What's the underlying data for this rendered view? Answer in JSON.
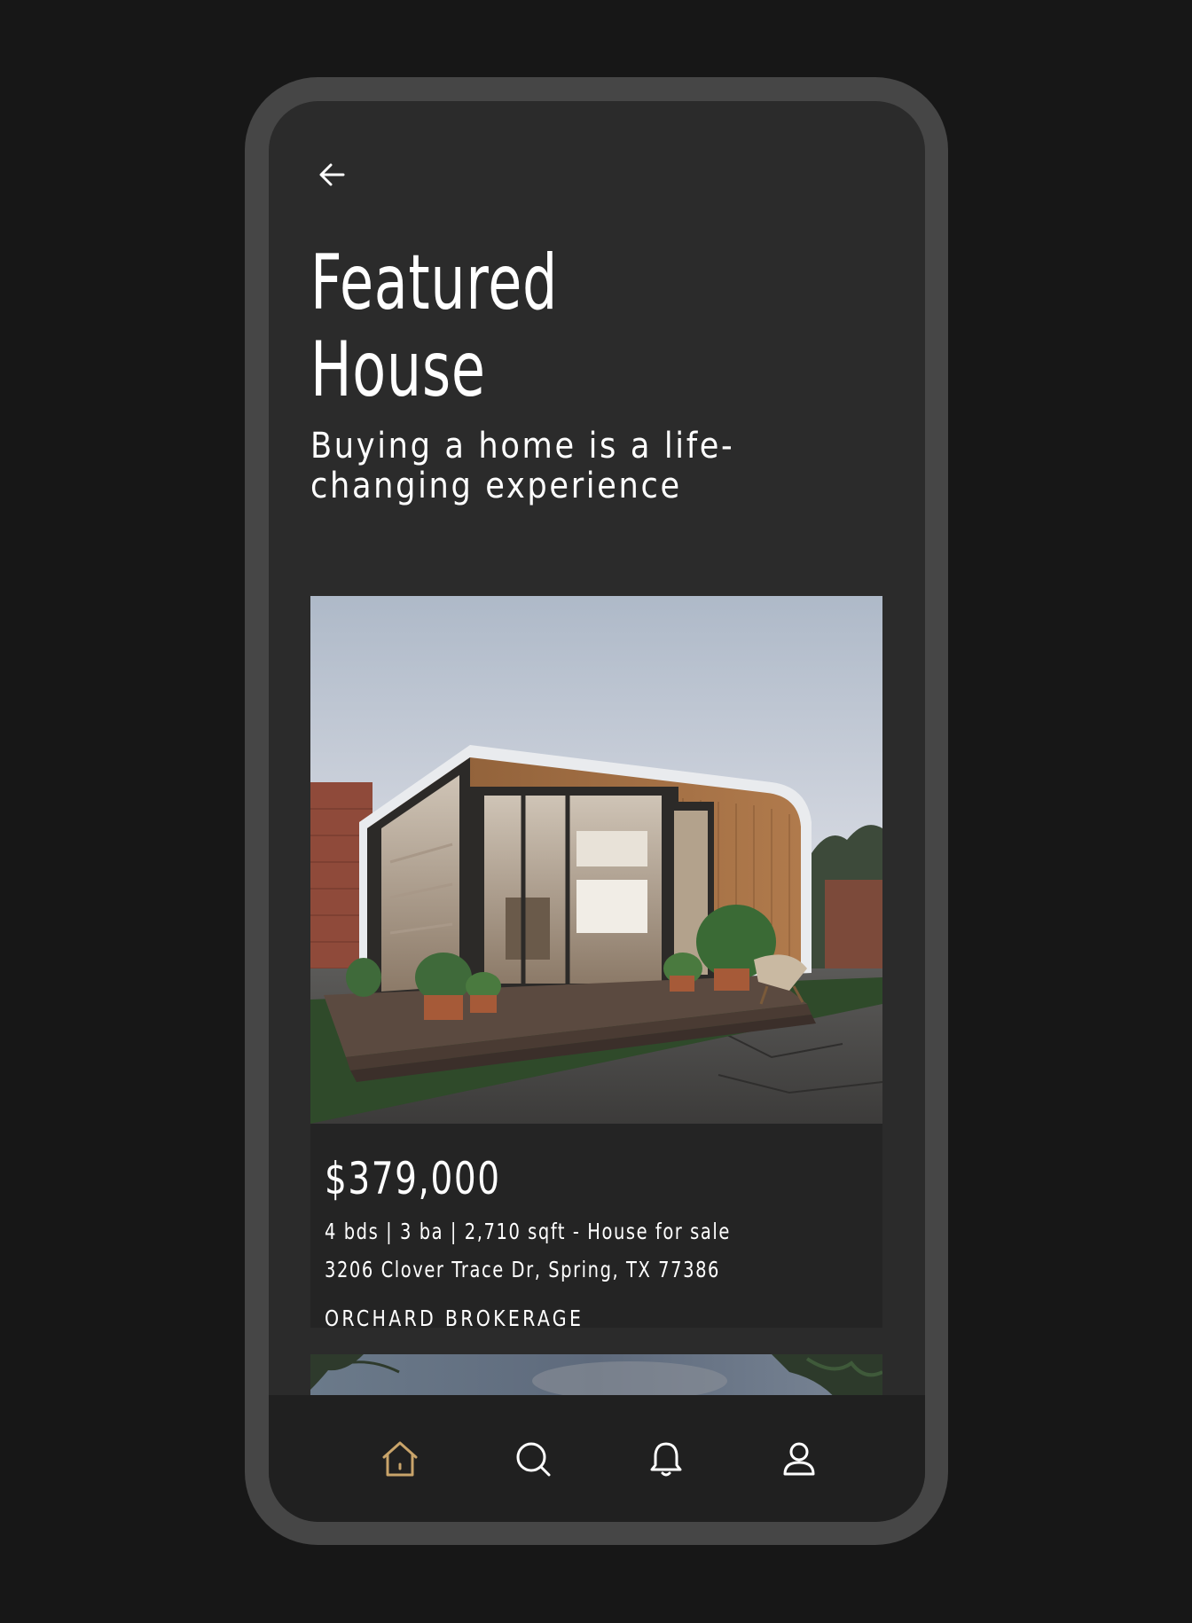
{
  "theme": {
    "background": "#171717",
    "frame": "#464646",
    "screen": "#2b2b2b",
    "card": "#242424",
    "nav": "#202020",
    "text": "#ffffff",
    "accent": "#c9a46a"
  },
  "header": {
    "back_icon": "arrow-left-icon",
    "title_line1": "Featured",
    "title_line2": "House",
    "subtitle": "Buying a home is a life-changing experience"
  },
  "listing": {
    "photo": "modern-tiny-house-photo",
    "price": "$379,000",
    "specs": "4 bds | 3 ba | 2,710 sqft - House for sale",
    "address": "3206 Clover Trace Dr, Spring, TX 77386",
    "brokerage": "ORCHARD BROKERAGE"
  },
  "next_listing": {
    "photo": "evening-sky-palm-photo"
  },
  "bottom_nav": {
    "items": [
      {
        "icon": "home-icon",
        "active": true
      },
      {
        "icon": "search-icon",
        "active": false
      },
      {
        "icon": "bell-icon",
        "active": false
      },
      {
        "icon": "user-icon",
        "active": false
      }
    ]
  }
}
